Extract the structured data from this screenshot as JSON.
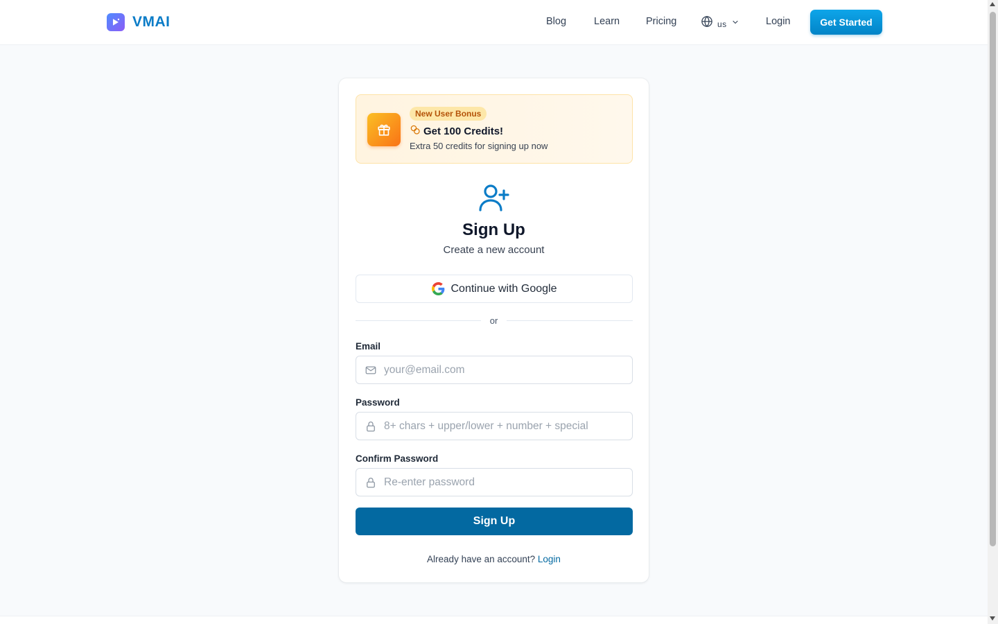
{
  "header": {
    "brand": "VMAI",
    "nav": {
      "blog": "Blog",
      "learn": "Learn",
      "pricing": "Pricing",
      "language": "us",
      "login": "Login",
      "get_started": "Get Started"
    }
  },
  "bonus": {
    "badge": "New User Bonus",
    "title": "Get 100 Credits!",
    "subtitle": "Extra 50 credits for signing up now"
  },
  "signup": {
    "title": "Sign Up",
    "subtitle": "Create a new account",
    "google_button": "Continue with Google",
    "divider": "or",
    "email": {
      "label": "Email",
      "placeholder": "your@email.com",
      "value": ""
    },
    "password": {
      "label": "Password",
      "placeholder": "8+ chars + upper/lower + number + special",
      "value": ""
    },
    "confirm_password": {
      "label": "Confirm Password",
      "placeholder": "Re-enter password",
      "value": ""
    },
    "submit": "Sign Up",
    "footer_text": "Already have an account?",
    "footer_link": "Login"
  },
  "icons": {
    "logo": "play-sparkle-icon",
    "language": "globe-icon",
    "language_caret": "chevron-down-icon",
    "gift": "gift-icon",
    "coins": "coins-icon",
    "user_plus": "user-plus-icon",
    "google": "google-icon",
    "email": "mail-icon",
    "password": "lock-icon"
  },
  "colors": {
    "brand": "#0b7cc7",
    "primary_button": "#0369a1",
    "cta_gradient_top": "#0ea5e9",
    "bonus_background": "#fff4e0",
    "bonus_badge": "#fde7a8",
    "gift_gradient_from": "#fbbf24",
    "gift_gradient_to": "#f97316"
  }
}
